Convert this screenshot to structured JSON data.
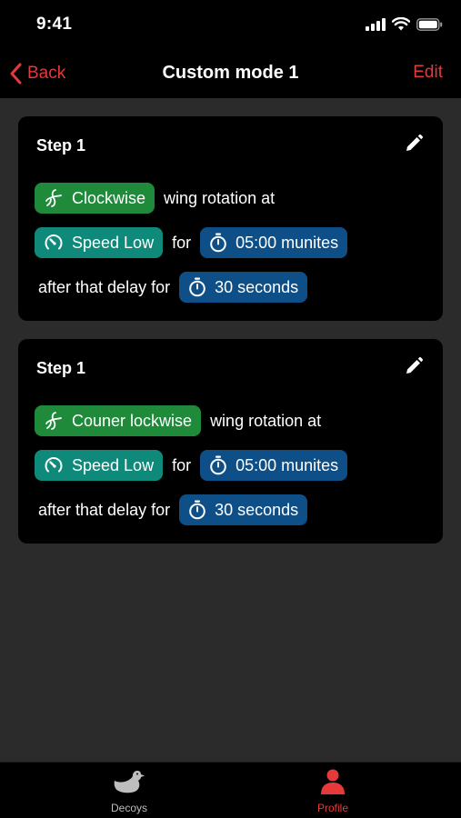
{
  "status_bar": {
    "time": "9:41"
  },
  "nav": {
    "back_label": "Back",
    "title": "Custom mode 1",
    "edit_label": "Edit"
  },
  "steps": [
    {
      "title": "Step 1",
      "rotation_label": "Clockwise",
      "rotation_text": "wing rotation at",
      "speed_label": "Speed Low",
      "for_text": "for",
      "duration_label": "05:00 munites",
      "delay_text": "after that delay for",
      "delay_label": "30 seconds"
    },
    {
      "title": "Step 1",
      "rotation_label": "Couner lockwise",
      "rotation_text": "wing rotation at",
      "speed_label": "Speed Low",
      "for_text": "for",
      "duration_label": "05:00 munites",
      "delay_text": "after that delay for",
      "delay_label": "30 seconds"
    }
  ],
  "tabs": [
    {
      "label": "Decoys",
      "icon": "duck-icon",
      "active": false
    },
    {
      "label": "Profile",
      "icon": "person-icon",
      "active": true
    }
  ],
  "colors": {
    "accent": "#e5393a",
    "rotation_chip": "#1e8a3a",
    "speed_chip": "#0f8a7a",
    "time_chip": "#0d4f86",
    "background": "#2b2b2b",
    "card": "#000000"
  }
}
